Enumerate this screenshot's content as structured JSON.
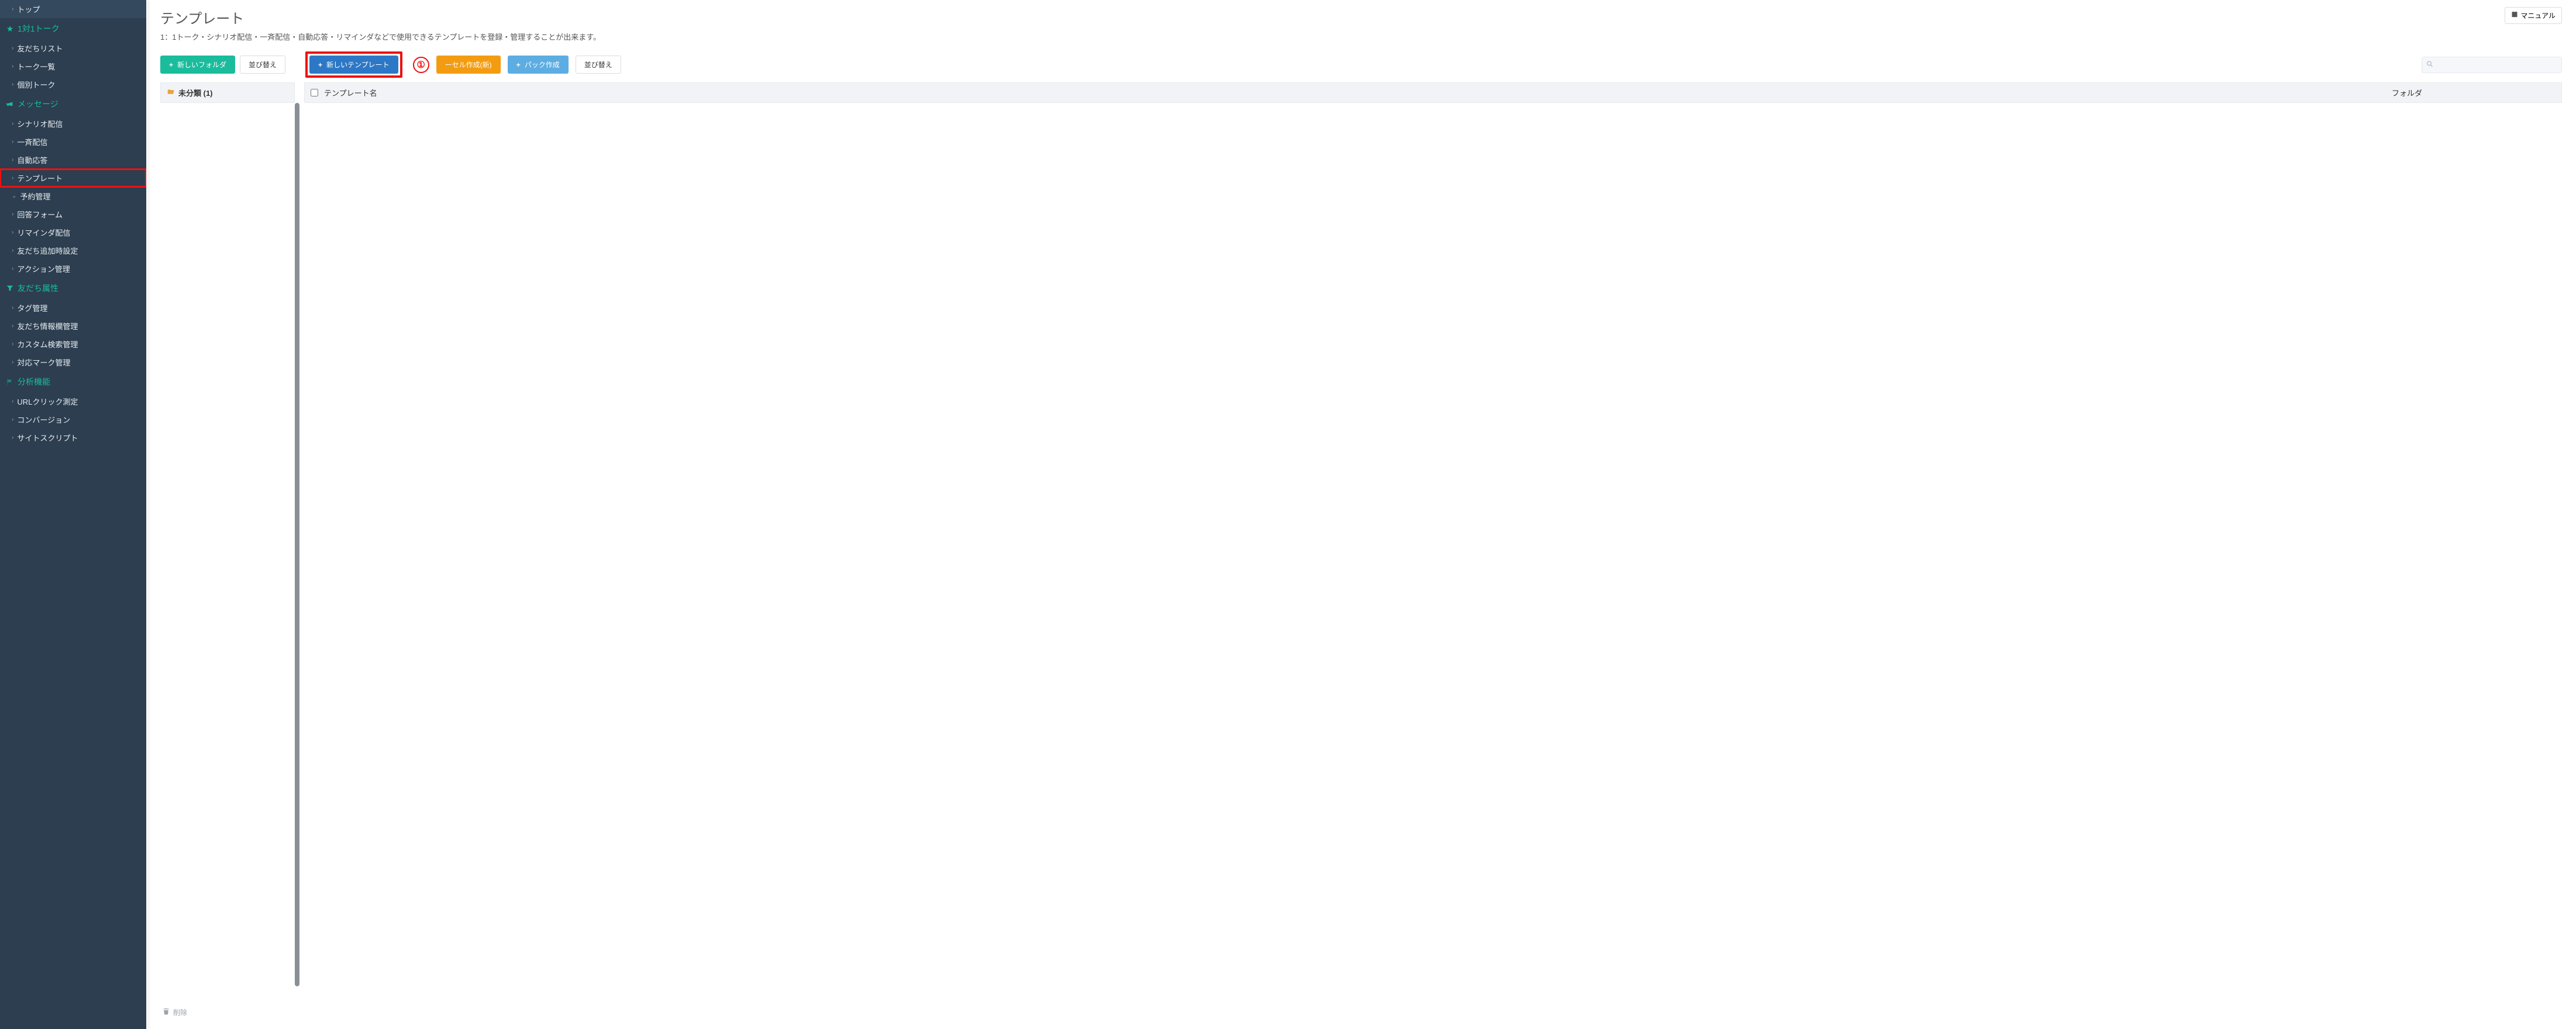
{
  "sidebar": {
    "top_item": "トップ",
    "sections": [
      {
        "icon": "star",
        "label": "1対1トーク",
        "items": [
          "友だちリスト",
          "トーク一覧",
          "個別トーク"
        ]
      },
      {
        "icon": "megaphone",
        "label": "メッセージ",
        "items": [
          "シナリオ配信",
          "一斉配信",
          "自動応答",
          "テンプレート",
          "予約管理",
          "回答フォーム",
          "リマインダ配信",
          "友だち追加時設定",
          "アクション管理"
        ],
        "highlighted_index": 3
      },
      {
        "icon": "filter",
        "label": "友だち属性",
        "items": [
          "タグ管理",
          "友だち情報欄管理",
          "カスタム検索管理",
          "対応マーク管理"
        ]
      },
      {
        "icon": "flag",
        "label": "分析機能",
        "items": [
          "URLクリック測定",
          "コンバージョン",
          "サイトスクリプト"
        ]
      }
    ]
  },
  "page": {
    "title": "テンプレート",
    "description": "1：1トーク・シナリオ配信・一斉配信・自動応答・リマインダなどで使用できるテンプレートを登録・管理することが出来ます。",
    "manual_btn": "マニュアル"
  },
  "toolbar": {
    "new_folder": "新しいフォルダ",
    "sort_left": "並び替え",
    "new_template": "新しいテンプレート",
    "step_indicator": "①",
    "carousel_new": "ーセル作成(新)",
    "pack_create": "パック作成",
    "sort_right": "並び替え",
    "search_placeholder": ""
  },
  "folders": {
    "uncategorized": "未分類 (1)",
    "delete": "削除"
  },
  "table": {
    "col_name": "テンプレート名",
    "col_folder": "フォルダ"
  }
}
